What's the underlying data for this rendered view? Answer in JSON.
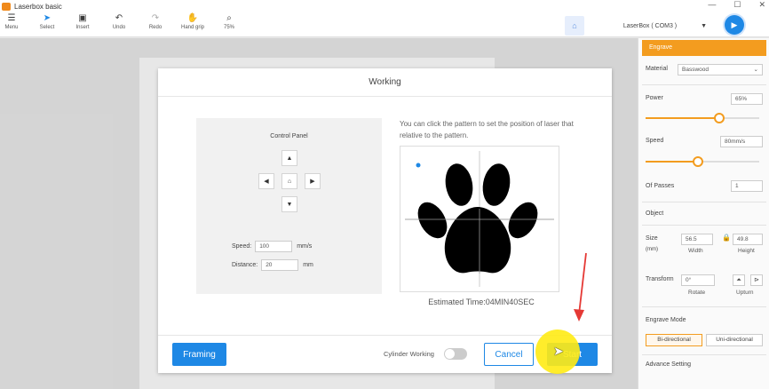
{
  "app": {
    "title": "Laserbox basic",
    "accent": "#f39c1f",
    "primary": "#1e88e5"
  },
  "window_controls": {
    "minimize": "—",
    "maximize": "☐",
    "close": "✕"
  },
  "toolbar": {
    "items": [
      {
        "label": "Menu",
        "icon": "menu-icon"
      },
      {
        "label": "Select",
        "icon": "select-cursor-icon"
      },
      {
        "label": "Insert",
        "icon": "insert-icon"
      },
      {
        "label": "Undo",
        "icon": "undo-icon"
      },
      {
        "label": "Redo",
        "icon": "redo-icon"
      },
      {
        "label": "Hand grip",
        "icon": "hand-icon"
      },
      {
        "label": "75%",
        "icon": "zoom-icon"
      }
    ],
    "device": "LaserBox ( COM3 )"
  },
  "modal": {
    "title": "Working",
    "control_panel": {
      "title": "Control Panel",
      "speed_label": "Speed:",
      "speed_value": "100",
      "speed_unit": "mm/s",
      "distance_label": "Distance:",
      "distance_value": "20",
      "distance_unit": "mm"
    },
    "hint": "You can click the pattern to set the position of laser that relative to the pattern.",
    "estimated_time": "Estimated Time:04MIN40SEC",
    "framing_label": "Framing",
    "cylinder_label": "Cylinder Working",
    "cylinder_on": false,
    "cancel_label": "Cancel",
    "start_label": "Start"
  },
  "panel": {
    "tab": "Engrave",
    "material_label": "Material",
    "material_value": "Basswood",
    "power_label": "Power",
    "power_value": "65%",
    "power_fraction": 0.65,
    "speed_label": "Speed",
    "speed_value": "80mm/s",
    "speed_fraction": 0.46,
    "passes_label": "Of Passes",
    "passes_value": "1",
    "object_label": "Object",
    "size_label": "Size",
    "size_unit": "(mm)",
    "width_value": "56.5",
    "height_value": "49.8",
    "width_label": "Width",
    "height_label": "Height",
    "transform_label": "Transform",
    "rotate_value": "0°",
    "rotate_label": "Rotate",
    "upturn_label": "Upturn",
    "engrave_mode_label": "Engrave Mode",
    "mode_bi": "Bi-directional",
    "mode_uni": "Uni-directional",
    "advance_label": "Advance Setting"
  }
}
